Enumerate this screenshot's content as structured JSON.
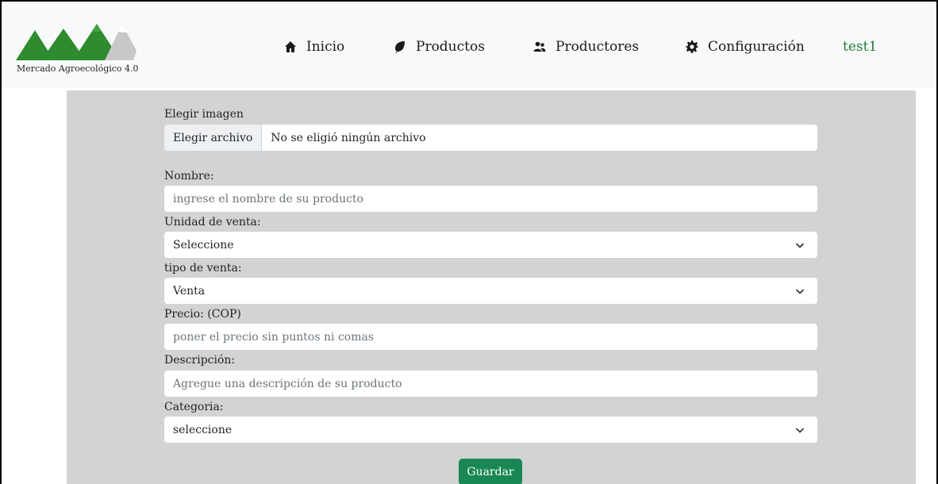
{
  "brand": {
    "name": "Mercado Agroecológico 4.0",
    "colors": {
      "mountain": "#2e8b2e",
      "peak": "#c8c8c8"
    }
  },
  "nav": {
    "items": [
      {
        "label": "Inicio",
        "icon": "home-icon"
      },
      {
        "label": "Productos",
        "icon": "leaf-icon"
      },
      {
        "label": "Productores",
        "icon": "users-icon"
      },
      {
        "label": "Configuración",
        "icon": "gear-icon"
      }
    ],
    "user": "test1"
  },
  "form": {
    "image": {
      "label": "Elegir imagen",
      "button": "Elegir archivo",
      "status": "No se eligió ningún archivo"
    },
    "name": {
      "label": "Nombre:",
      "placeholder": "ingrese el nombre de su producto"
    },
    "unit": {
      "label": "Unidad de venta:",
      "value": "Seleccione"
    },
    "sale_type": {
      "label": "tipo de venta:",
      "value": "Venta"
    },
    "price": {
      "label": "Precio: (COP)",
      "placeholder": "poner el precio sin puntos ni comas"
    },
    "description": {
      "label": "Descripción:",
      "placeholder": "Agregue una descripción de su producto"
    },
    "category": {
      "label": "Categoria:",
      "value": "seleccione"
    },
    "submit": "Guardar"
  },
  "colors": {
    "panel": "#d3d3d3",
    "navbar": "#f8f9fa",
    "primary": "#198754",
    "user": "#1e7e34"
  }
}
